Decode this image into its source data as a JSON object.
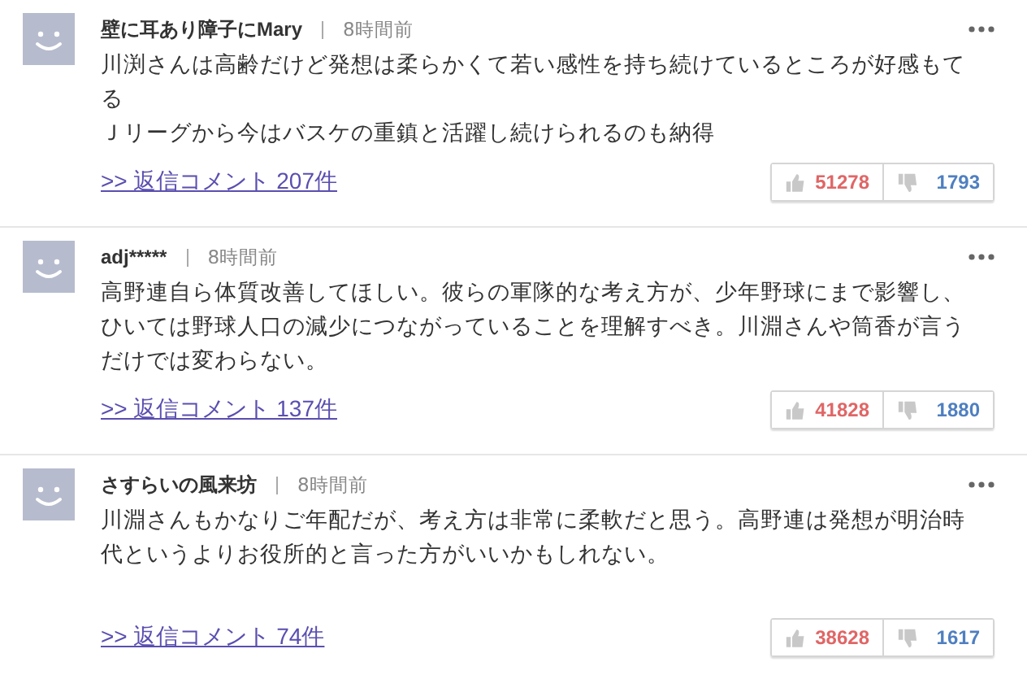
{
  "comments": [
    {
      "author": "壁に耳あり障子にMary",
      "time": "8時間前",
      "body": [
        "川渕さんは高齢だけど発想は柔らかくて若い感性を持ち続けているところが好感もてる",
        "Ｊリーグから今はバスケの重鎮と活躍し続けられるのも納得"
      ],
      "replies": ">> 返信コメント 207件",
      "likes": "51278",
      "dislikes": "1793"
    },
    {
      "author": "adj*****",
      "time": "8時間前",
      "body": [
        "高野連自ら体質改善してほしい。彼らの軍隊的な考え方が、少年野球にまで影響し、ひいては野球人口の減少につながっていることを理解すべき。川淵さんや筒香が言うだけでは変わらない。"
      ],
      "replies": ">> 返信コメント 137件",
      "likes": "41828",
      "dislikes": "1880"
    },
    {
      "author": "さすらいの風来坊",
      "time": "8時間前",
      "body": [
        "川淵さんもかなりご年配だが、考え方は非常に柔軟だと思う。高野連は発想が明治時代というよりお役所的と言った方がいいかもしれない。"
      ],
      "replies": ">> 返信コメント 74件",
      "likes": "38628",
      "dislikes": "1617"
    }
  ]
}
